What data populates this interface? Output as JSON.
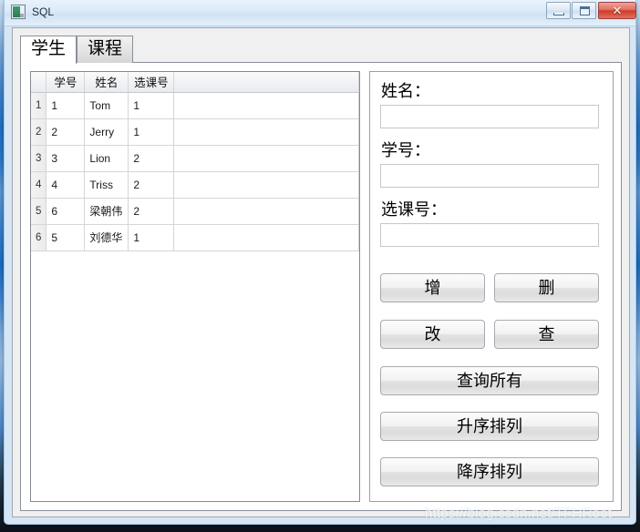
{
  "window": {
    "title": "SQL",
    "icon": "app-icon",
    "controls": {
      "minimize": "minimize-icon",
      "maximize": "maximize-icon",
      "close_label": "✕"
    }
  },
  "tabs": [
    {
      "label": "学生",
      "selected": true
    },
    {
      "label": "课程",
      "selected": false
    }
  ],
  "grid": {
    "columns": [
      "",
      "学号",
      "姓名",
      "选课号",
      ""
    ],
    "rows": [
      {
        "n": "1",
        "sid": "1",
        "name": "Tom",
        "cid": "1"
      },
      {
        "n": "2",
        "sid": "2",
        "name": "Jerry",
        "cid": "1"
      },
      {
        "n": "3",
        "sid": "3",
        "name": "Lion",
        "cid": "2"
      },
      {
        "n": "4",
        "sid": "4",
        "name": "Triss",
        "cid": "2"
      },
      {
        "n": "5",
        "sid": "6",
        "name": "梁朝伟",
        "cid": "2"
      },
      {
        "n": "6",
        "sid": "5",
        "name": "刘德华",
        "cid": "1"
      }
    ]
  },
  "form": {
    "fields": [
      {
        "label": "姓名：",
        "value": "",
        "placeholder": ""
      },
      {
        "label": "学号：",
        "value": "",
        "placeholder": ""
      },
      {
        "label": "选课号：",
        "value": "",
        "placeholder": ""
      }
    ],
    "buttons": [
      {
        "label": "增",
        "size": "half"
      },
      {
        "label": "删",
        "size": "half"
      },
      {
        "label": "改",
        "size": "half"
      },
      {
        "label": "查",
        "size": "half"
      },
      {
        "label": "查询所有",
        "size": "full"
      },
      {
        "label": "升序排列",
        "size": "full"
      },
      {
        "label": "降序排列",
        "size": "full"
      }
    ]
  },
  "watermark": "https://blog.csdn.net/TFHRoot",
  "colors": {
    "window_frame": "#d6e6f5",
    "client_bg": "#f0f0f0",
    "panel_bg": "#ffffff",
    "close_button": "#cc3c26",
    "grid_line": "#d6d6d6"
  }
}
